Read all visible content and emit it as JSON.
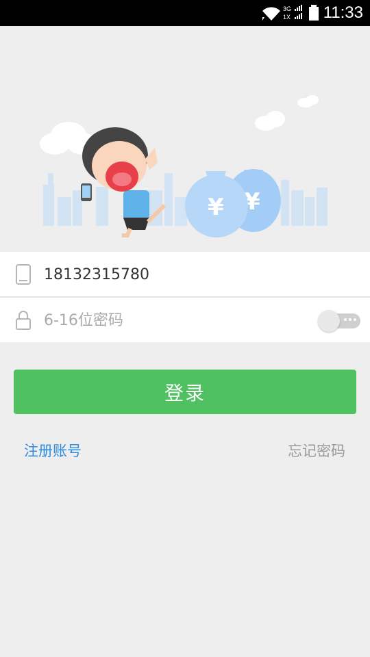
{
  "status_bar": {
    "time": "11:33",
    "network_top": "3G",
    "network_bottom": "1X",
    "icons": [
      "wifi-icon",
      "signal-icon",
      "battery-icon"
    ]
  },
  "banner": {
    "illustration": "cartoon girl with phone and money bags",
    "money_symbol": "¥"
  },
  "form": {
    "phone": {
      "value": "18132315780",
      "icon": "phone-icon"
    },
    "password": {
      "placeholder": "6-16位密码",
      "icon": "lock-icon",
      "toggle_state": "off"
    },
    "login_label": "登录"
  },
  "links": {
    "register": "注册账号",
    "forgot": "忘记密码"
  },
  "colors": {
    "primary": "#4fc160",
    "link": "#2d8ce0",
    "muted": "#999999",
    "background": "#eeeeee"
  }
}
